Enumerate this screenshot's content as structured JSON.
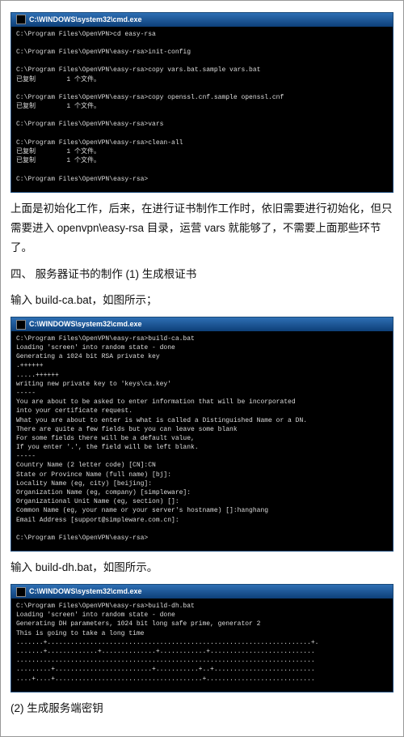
{
  "terminals": {
    "t1": {
      "title": "C:\\WINDOWS\\system32\\cmd.exe",
      "lines": "C:\\Program Files\\OpenVPN>cd easy-rsa\n\nC:\\Program Files\\OpenVPN\\easy-rsa>init-config\n\nC:\\Program Files\\OpenVPN\\easy-rsa>copy vars.bat.sample vars.bat\n已复制        1 个文件。\n\nC:\\Program Files\\OpenVPN\\easy-rsa>copy openssl.cnf.sample openssl.cnf\n已复制        1 个文件。\n\nC:\\Program Files\\OpenVPN\\easy-rsa>vars\n\nC:\\Program Files\\OpenVPN\\easy-rsa>clean-all\n已复制        1 个文件。\n已复制        1 个文件。\n\nC:\\Program Files\\OpenVPN\\easy-rsa>"
    },
    "t2": {
      "title": "C:\\WINDOWS\\system32\\cmd.exe",
      "lines": "C:\\Program Files\\OpenVPN\\easy-rsa>build-ca.bat\nLoading 'screen' into random state - done\nGenerating a 1024 bit RSA private key\n.++++++\n.....++++++\nwriting new private key to 'keys\\ca.key'\n-----\nYou are about to be asked to enter information that will be incorporated\ninto your certificate request.\nWhat you are about to enter is what is called a Distinguished Name or a DN.\nThere are quite a few fields but you can leave some blank\nFor some fields there will be a default value,\nIf you enter '.', the field will be left blank.\n-----\nCountry Name (2 letter code) [CN]:CN\nState or Province Name (full name) [bj]:\nLocality Name (eg, city) [beijing]:\nOrganization Name (eg, company) [simpleware]:\nOrganizational Unit Name (eg, section) []:\nCommon Name (eg, your name or your server's hostname) []:hanghang\nEmail Address [support@simpleware.com.cn]:\n\nC:\\Program Files\\OpenVPN\\easy-rsa>"
    },
    "t3": {
      "title": "C:\\WINDOWS\\system32\\cmd.exe",
      "lines": "C:\\Program Files\\OpenVPN\\easy-rsa>build-dh.bat\nLoading 'screen' into random state - done\nGenerating DH parameters, 1024 bit long safe prime, generator 2\nThis is going to take a long time\n.......+....................................................................+.\n.......+.............+..............+............+...........................\n.............................................................................\n.........+.........................+...........+..+..........................\n....+....+......................................+............................"
    }
  },
  "paragraphs": {
    "p1": "上面是初始化工作，后来，在进行证书制作工作时，依旧需要进行初始化，但只需要进入 openvpn\\easy-rsa 目录，运营 vars 就能够了，不需要上面那些环节了。",
    "p2": "四、 服务器证书的制作 (1) 生成根证书",
    "p3": "输入 build-ca.bat，如图所示；",
    "p4": "输入 build-dh.bat，如图所示。",
    "p5": "(2) 生成服务端密钥"
  }
}
